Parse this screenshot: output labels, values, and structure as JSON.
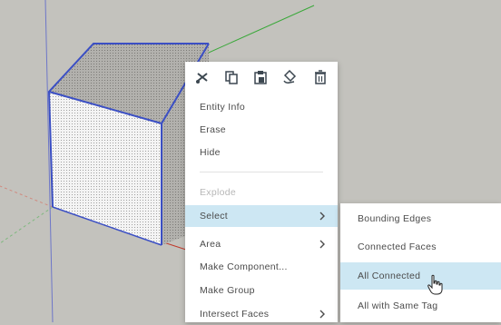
{
  "toolbar": {
    "icons": [
      "cut-icon",
      "copy-icon",
      "paste-icon",
      "paint-bucket-icon",
      "delete-icon"
    ]
  },
  "menu": {
    "entity_info": "Entity Info",
    "erase": "Erase",
    "hide": "Hide",
    "explode": "Explode",
    "select": "Select",
    "area": "Area",
    "make_component": "Make Component...",
    "make_group": "Make Group",
    "intersect_faces": "Intersect Faces"
  },
  "submenu": {
    "bounding_edges": "Bounding Edges",
    "connected_faces": "Connected Faces",
    "all_connected": "All Connected",
    "all_with_same_tag": "All with Same Tag"
  },
  "colors": {
    "canvas": "#c3c2bd",
    "selection_edge": "#3b4fc4",
    "highlight": "#cde7f3",
    "green_axis": "#3aa83a",
    "red_axis": "#c0392b"
  }
}
